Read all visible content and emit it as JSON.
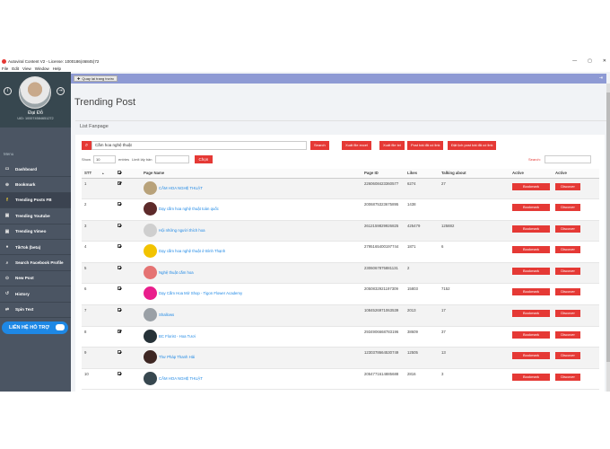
{
  "window": {
    "title": "Autoviral Content V2 - License: 1000186(46845)72",
    "menu": [
      "File",
      "Edit",
      "View",
      "Window",
      "Help"
    ],
    "controls": [
      "—",
      "▢",
      "✕"
    ]
  },
  "profile": {
    "name": "Đại Đỗ",
    "id": "UID: 100074584651272"
  },
  "sidebar": {
    "title": "Menu",
    "items": [
      {
        "label": "Dashboard",
        "icon": "dashboard-icon",
        "glyph": "▭"
      },
      {
        "label": "Bookmark",
        "icon": "bookmark-icon",
        "glyph": "⊕"
      },
      {
        "label": "Trending Posts FB",
        "icon": "facebook-icon",
        "glyph": "f"
      },
      {
        "label": "Trending Youtube",
        "icon": "youtube-icon",
        "glyph": "▣"
      },
      {
        "label": "Trending Vimeo",
        "icon": "vimeo-icon",
        "glyph": "▣"
      },
      {
        "label": "TikTok (beta)",
        "icon": "tiktok-icon",
        "glyph": "●"
      },
      {
        "label": "Search Facebook Profile",
        "icon": "search-icon",
        "glyph": "⌕"
      },
      {
        "label": "New Post",
        "icon": "new-post-icon",
        "glyph": "⊙"
      },
      {
        "label": "History",
        "icon": "history-icon",
        "glyph": "↺"
      },
      {
        "label": "Spin Text",
        "icon": "spin-icon",
        "glyph": "⇄"
      }
    ],
    "contact": "LIÊN HỆ HỖ TRỢ"
  },
  "topbar": {
    "back": "Quay lại trang trước",
    "exit_glyph": "⇥"
  },
  "page": {
    "title": "Trending Post",
    "subtitle": "List Fanpage"
  },
  "search": {
    "value": "Cắm hoa nghệ thuật",
    "button": "Search"
  },
  "actions": [
    "Xuất file excel",
    "Xuất file txt",
    "Post bài đã có link",
    "Đặt lịch post bài đã có link"
  ],
  "controls": {
    "show": "Show",
    "entries_value": "10",
    "entries": "entries",
    "limit_label": "Limit lấy bản",
    "chon": "Chọn",
    "search_label": "Search:"
  },
  "table": {
    "headers": [
      "STT",
      "",
      "Page Name",
      "Page ID",
      "Likes",
      "Talking about",
      "Active",
      "Active"
    ],
    "sort_glyph": "▲",
    "bookmark_label": "Bookmark",
    "discover_label": "Discover",
    "rows": [
      {
        "stt": "1",
        "name": "CẮM HOA NGHỆ THUẬT",
        "page_id": "2260608423360577",
        "likes": "6274",
        "talking": "27",
        "avatar": "#b8a27a"
      },
      {
        "stt": "2",
        "name": "Dạy cắm hoa nghệ thuật toàn quốc",
        "page_id": "2006875323675895",
        "likes": "1438",
        "talking": "",
        "avatar": "#5d2a2a"
      },
      {
        "stt": "3",
        "name": "Hội những người thích hoa",
        "page_id": "2612159829926825",
        "likes": "425479",
        "talking": "125882",
        "avatar": "#cfcfcf"
      },
      {
        "stt": "4",
        "name": "Dạy cắm hoa nghệ thuật ở Bình Thạnh",
        "page_id": "2795165400197744",
        "likes": "1871",
        "talking": "6",
        "avatar": "#f2c300"
      },
      {
        "stt": "5",
        "name": "Nghệ thuật cắm hoa",
        "page_id": "2306067875881131",
        "likes": "2",
        "talking": "",
        "avatar": "#e57373"
      },
      {
        "stt": "6",
        "name": "Dạy Cắm Hoa Mở Shop - Tigon Flower Academy",
        "page_id": "2050832921197309",
        "likes": "15803",
        "talking": "7152",
        "avatar": "#e91e8c"
      },
      {
        "stt": "7",
        "name": "Shallows",
        "page_id": "1084526971063539",
        "likes": "2013",
        "talking": "17",
        "avatar": "#9aa0a6"
      },
      {
        "stt": "8",
        "name": "BC Florist - Hoa Tươi",
        "page_id": "2934906668783196",
        "likes": "38609",
        "talking": "37",
        "avatar": "#263238"
      },
      {
        "stt": "9",
        "name": "Thư Pháp Thanh Hải",
        "page_id": "1230378664530749",
        "likes": "12505",
        "talking": "13",
        "avatar": "#3e2723"
      },
      {
        "stt": "10",
        "name": "CẮM HOA NGHỆ THUẬT",
        "page_id": "2054771614885688",
        "likes": "2816",
        "talking": "3",
        "avatar": "#37474f"
      }
    ]
  },
  "colors": {
    "accent": "#e53935",
    "sidebar": "#4b5563",
    "topbar": "#8e9ad4",
    "link": "#1e88e5"
  }
}
